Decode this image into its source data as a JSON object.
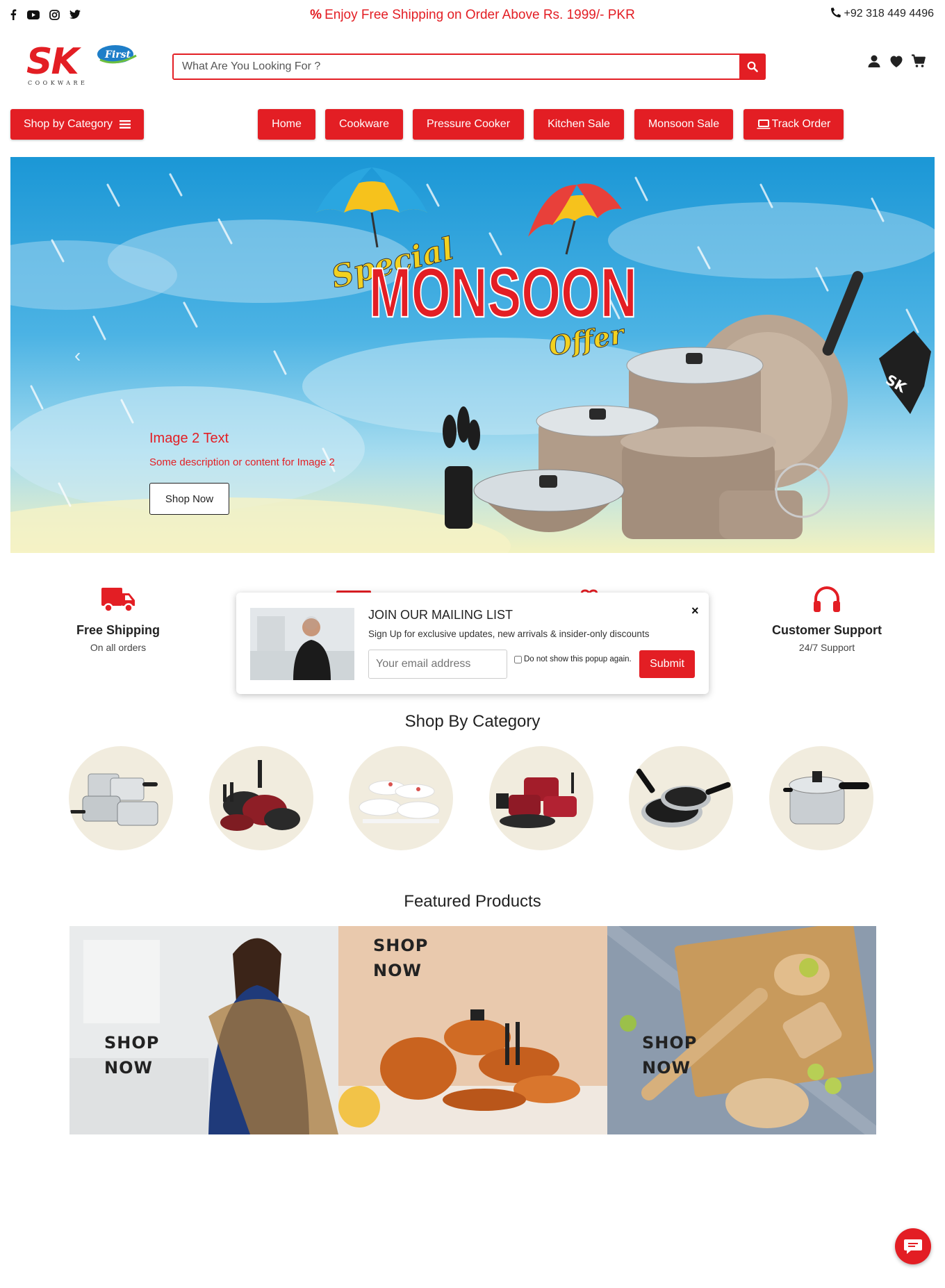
{
  "topbar": {
    "social_icons": [
      "facebook-icon",
      "youtube-icon",
      "instagram-icon",
      "twitter-icon"
    ],
    "promo_text": "Enjoy Free Shipping on Order Above Rs. 1999/- PKR",
    "phone": "+92 318 449 4496"
  },
  "header": {
    "logo_text": "SK",
    "logo_sub": "COOKWARE",
    "logo_badge": "First",
    "search_placeholder": "What Are You Looking For ?",
    "icons": [
      "user-icon",
      "heart-icon",
      "cart-icon"
    ]
  },
  "nav": {
    "category_button": "Shop by Category",
    "items": [
      "Home",
      "Cookware",
      "Pressure Cooker",
      "Kitchen Sale",
      "Monsoon Sale",
      "Track Order"
    ]
  },
  "hero": {
    "banner_word1": "Special",
    "banner_word2": "MONSOON",
    "banner_word3": "Offer",
    "caption_title": "Image 2 Text",
    "caption_desc": "Some description or content for Image 2",
    "button": "Shop Now"
  },
  "features": [
    {
      "title": "Free Shipping",
      "subtitle": "On all orders"
    },
    {
      "title": "Customer Support",
      "subtitle": "24/7 Support"
    }
  ],
  "popup": {
    "title": "JOIN OUR MAILING LIST",
    "description": "Sign Up for exclusive updates, new arrivals & insider-only discounts",
    "email_placeholder": "Your email address",
    "checkbox_label": "Do not show this popup again.",
    "submit": "Submit",
    "close": "×"
  },
  "categories": {
    "heading": "Shop By Category",
    "items": [
      "stainless-cookware-set",
      "nonstick-cookware-set",
      "dinner-set",
      "red-cookware-set",
      "frying-pans",
      "pressure-cooker"
    ]
  },
  "featured": {
    "heading": "Featured Products",
    "cards": [
      {
        "label_line1": "SHOP",
        "label_line2": "NOW"
      },
      {
        "label_line1": "SHOP",
        "label_line2": "NOW"
      },
      {
        "label_line1": "SHOP",
        "label_line2": "NOW"
      }
    ]
  },
  "colors": {
    "brand_red": "#e31e24",
    "category_bg": "#f1ecde"
  }
}
